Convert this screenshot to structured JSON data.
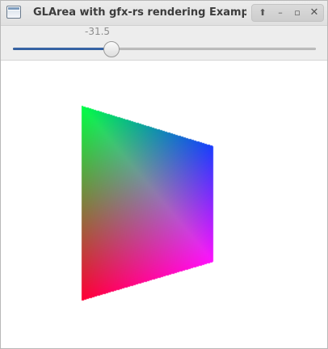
{
  "window": {
    "title": "GLArea with gfx-rs rendering Example"
  },
  "title_controls": {
    "up_glyph": "⬆",
    "minimize_glyph": "–",
    "maximize_glyph": "▫",
    "close_glyph": "✕"
  },
  "scale": {
    "value_label": "-31.5",
    "min": -90,
    "max": 90,
    "value": -31.5
  },
  "scene": {
    "shape": "quad",
    "corner_colors": {
      "top_left": "#00ff44",
      "top_right": "#1a3cff",
      "bottom_right": "#ff10ff",
      "bottom_left": "#ff0033"
    }
  },
  "icons": [
    "app-window-icon",
    "keep-above-icon",
    "minimize-icon",
    "maximize-icon",
    "close-icon"
  ]
}
